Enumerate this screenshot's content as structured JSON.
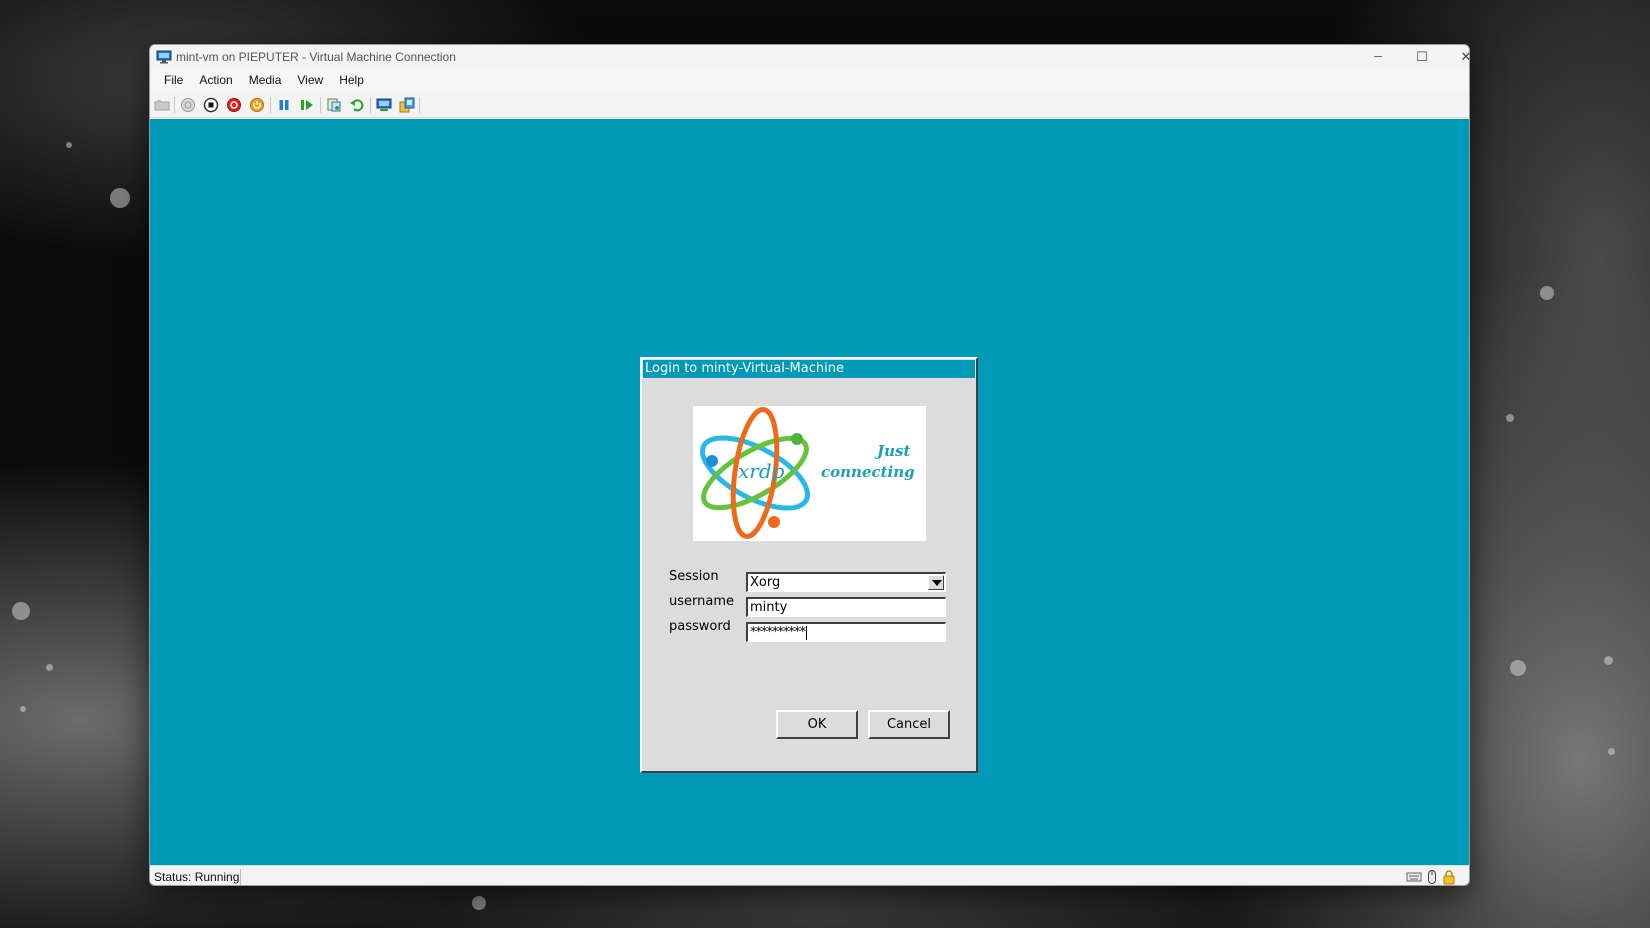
{
  "window": {
    "title": "mint-vm on PIEPUTER - Virtual Machine Connection",
    "minimize_glyph": "─",
    "maximize_glyph": "☐",
    "close_glyph": "✕"
  },
  "menu": {
    "items": [
      "File",
      "Action",
      "Media",
      "View",
      "Help"
    ]
  },
  "toolbar": {
    "icons": [
      "ctrl-alt-del-icon",
      "start-icon",
      "turn-off-icon",
      "shut-down-icon",
      "save-icon",
      "pause-icon",
      "resume-icon",
      "checkpoint-icon",
      "revert-icon",
      "enhanced-session-icon",
      "share-icon"
    ]
  },
  "status": {
    "text": "Status: Running"
  },
  "dialog": {
    "title": "Login to minty-Virtual-Machine",
    "logo": {
      "name": "xrdp",
      "tagline_line1": "Just",
      "tagline_line2": "connecting"
    },
    "session_label": "Session",
    "session_value": "Xorg",
    "username_label": "username",
    "username_value": "minty",
    "password_label": "password",
    "password_value": "**********",
    "ok_label": "OK",
    "cancel_label": "Cancel"
  },
  "colors": {
    "vm_background": "#009ab8",
    "dialog_background": "#dcdcdc",
    "dialog_title_bar": "#009ab8"
  }
}
